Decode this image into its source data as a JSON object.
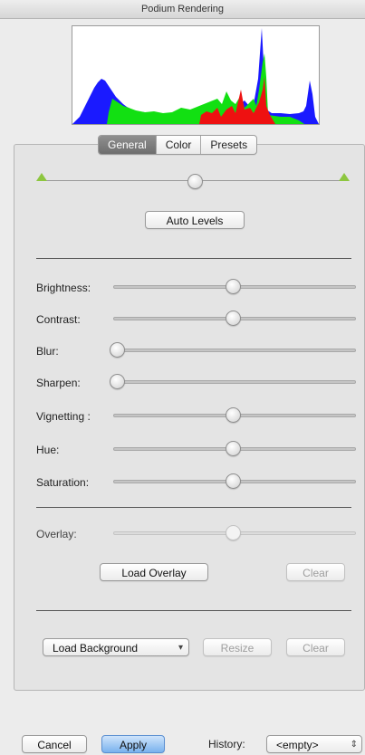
{
  "window": {
    "title": "Podium Rendering"
  },
  "histogram": {
    "series_colors": {
      "blue": "#1a1aff",
      "green": "#12e012",
      "red": "#ee1111"
    }
  },
  "tabs": [
    {
      "label": "General",
      "active": true
    },
    {
      "label": "Color",
      "active": false
    },
    {
      "label": "Presets",
      "active": false
    }
  ],
  "levels": {
    "auto_levels_label": "Auto Levels",
    "position": 0.5
  },
  "adjustments": [
    {
      "label": "Brightness:",
      "value": 0.5
    },
    {
      "label": "Contrast:",
      "value": 0.5
    },
    {
      "label": "Blur:",
      "value": 0.0
    },
    {
      "label": "Sharpen:",
      "value": 0.0
    },
    {
      "label": "Vignetting :",
      "value": 0.5
    },
    {
      "label": "Hue:",
      "value": 0.5
    },
    {
      "label": "Saturation:",
      "value": 0.5
    }
  ],
  "overlay": {
    "label": "Overlay:",
    "value": 0.5,
    "load_label": "Load Overlay",
    "clear_label": "Clear"
  },
  "background": {
    "load_label": "Load Background",
    "resize_label": "Resize",
    "clear_label": "Clear"
  },
  "footer": {
    "cancel_label": "Cancel",
    "apply_label": "Apply",
    "history_label": "History:",
    "history_value": "<empty>"
  }
}
